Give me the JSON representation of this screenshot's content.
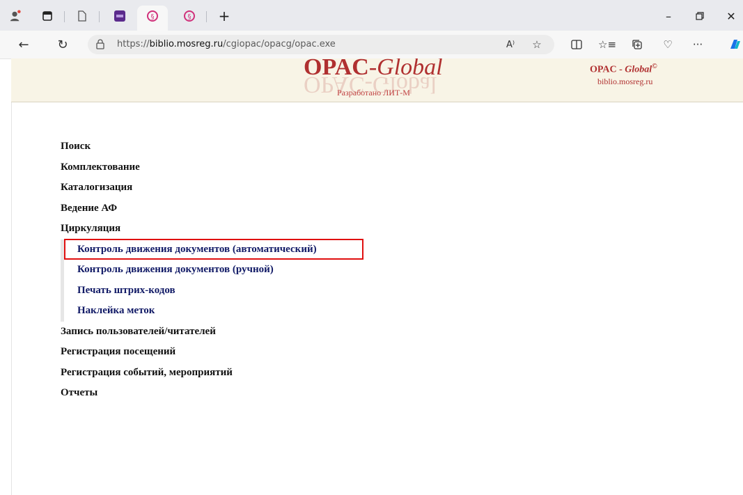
{
  "browser": {
    "url_prefix": "https://",
    "url_host": "biblio.mosreg.ru",
    "url_path": "/cgiopac/opacg/opac.exe",
    "accent_color": "#1a73e8"
  },
  "header": {
    "logo_bold": "OPAC",
    "logo_dash": "-",
    "logo_italic": "Global",
    "developer": "Разработано ЛИТ-М",
    "right_title_bold": "OPAC - ",
    "right_title_italic": "Global",
    "right_copyright": "©",
    "right_site": "biblio.mosreg.ru"
  },
  "menu": {
    "items_top": [
      "Поиск",
      "Комплектование",
      "Каталогизация",
      "Ведение АФ",
      "Циркуляция"
    ],
    "submenu": [
      "Контроль движения документов (автоматический)",
      "Контроль движения документов (ручной)",
      "Печать штрих-кодов",
      "Наклейка меток"
    ],
    "items_bottom": [
      "Запись пользователей/читателей",
      "Регистрация посещений",
      "Регистрация событий, мероприятий",
      "Отчеты"
    ]
  },
  "colors": {
    "highlight_border": "#e01010",
    "logo": "#b03030",
    "submenu_text": "#111a66",
    "header_bg": "#f8f4e6"
  }
}
